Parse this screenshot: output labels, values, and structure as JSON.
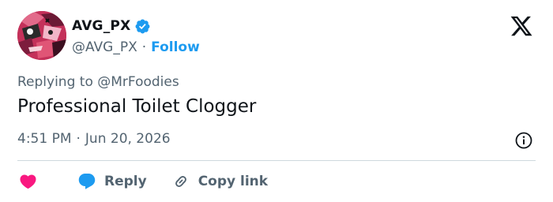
{
  "author": {
    "display_name": "AVG_PX",
    "handle": "@AVG_PX",
    "separator": "·",
    "follow_label": "Follow",
    "verified": true
  },
  "tweet": {
    "replying_prefix": "Replying to",
    "replying_to": "@MrFoodies",
    "text": "Professional Toilet Clogger",
    "time": "4:51 PM",
    "date_separator": "·",
    "date": "Jun 20, 2026"
  },
  "actions": {
    "like_label": "",
    "reply_label": "Reply",
    "copy_link_label": "Copy link"
  },
  "icons": {
    "logo": "x-logo-icon",
    "verified": "verified-badge-icon",
    "info": "info-icon",
    "like": "heart-icon",
    "reply": "speech-bubble-icon",
    "copy": "link-icon"
  },
  "colors": {
    "accent": "#1d9bf0",
    "like": "#f91880",
    "text_primary": "#0f1419",
    "text_secondary": "#536471",
    "divider": "#cfd9de"
  }
}
